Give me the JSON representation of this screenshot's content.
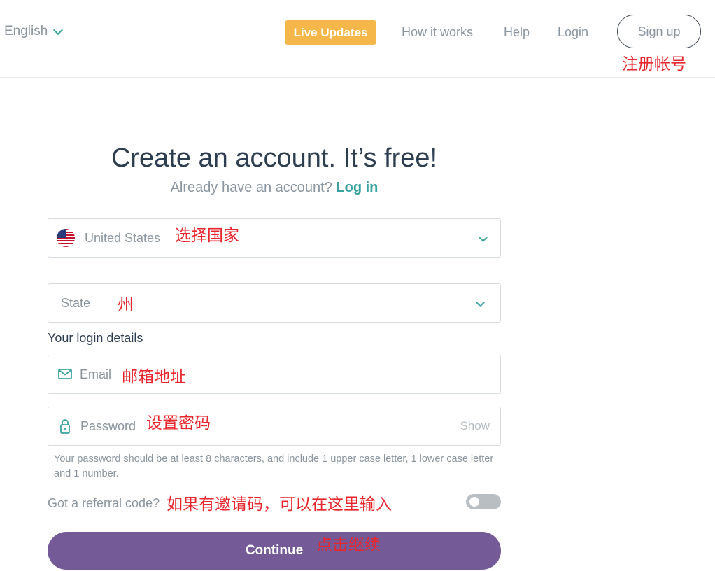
{
  "header": {
    "language": "English",
    "live_updates": "Live Updates",
    "how_it_works": "How it works",
    "help": "Help",
    "login": "Login",
    "sign_up": "Sign up",
    "accent_color": "#f5b64a"
  },
  "page": {
    "title": "Create an account. It’s free!",
    "subtitle": "Already have an account?",
    "login_link": "Log in"
  },
  "form": {
    "country": {
      "value": "United States",
      "icon": "us-flag-icon"
    },
    "state": {
      "placeholder": "State"
    },
    "login_details_label": "Your login details",
    "email": {
      "placeholder": "Email",
      "icon": "mail-icon"
    },
    "password": {
      "placeholder": "Password",
      "icon": "lock-icon",
      "show_label": "Show"
    },
    "password_hint": "Your password should be at least 8 characters, and include 1 upper case letter, 1 lower case letter and 1 number.",
    "referral_label": "Got a referral code?",
    "referral_toggle_on": false,
    "continue_label": "Continue",
    "continue_color": "#745a97"
  },
  "annotations": {
    "sign_up": "注册帐号",
    "country": "选择国家",
    "state": "州",
    "email": "邮箱地址",
    "password": "设置密码",
    "referral": "如果有邀请码，可以在这里输入",
    "continue": "点击继续"
  }
}
